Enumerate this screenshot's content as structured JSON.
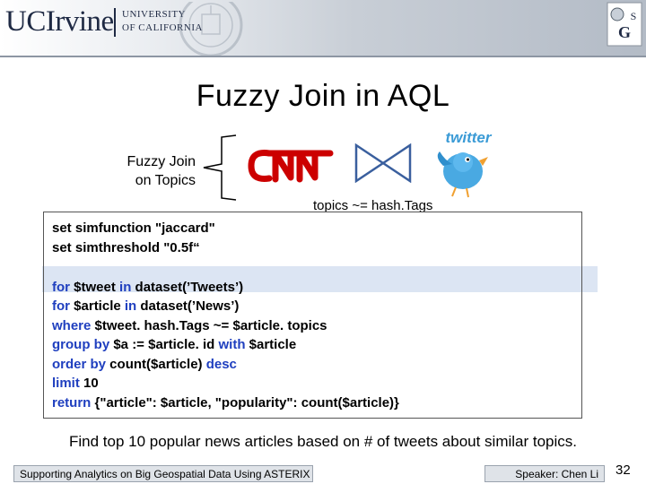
{
  "header": {
    "brand": "UCIrvine",
    "university_line1": "UNIVERSITY",
    "university_line2": "OF CALIFORNIA",
    "isg_logo_text": "ISG"
  },
  "slide": {
    "title": "Fuzzy Join in AQL",
    "fuzzy_label_line1": "Fuzzy Join",
    "fuzzy_label_line2": "on Topics",
    "topics_label": "topics ~= hash.Tags",
    "cnn_logo_icon": "cnn-logo",
    "twitter_logo_icon": "twitter-bird-logo",
    "twitter_text": "twitter"
  },
  "code": {
    "line1": "set simfunction \"jaccard\"",
    "line2": "set simthreshold \"0.5f“",
    "line3_kw1": "for",
    "line3_a": " $tweet ",
    "line3_kw2": "in",
    "line3_b": " dataset(’Tweets’)",
    "line4_kw1": "for",
    "line4_a": " $article ",
    "line4_kw2": "in",
    "line4_b": " dataset(’News’)",
    "line5_kw": "where",
    "line5_a": " $tweet. hash.Tags ~= $article. topics",
    "line6_kw1": "group by",
    "line6_a": " $a := $article. id ",
    "line6_kw2": "with",
    "line6_b": " $article",
    "line7_kw1": "order by",
    "line7_a": " count($article) ",
    "line7_kw2": "desc",
    "line8_kw": "limit",
    "line8_a": " 10",
    "line9_kw": "return",
    "line9_a": " {\"article\": $article, \"popularity\": count($article)}"
  },
  "caption": "Find top 10 popular news articles based on # of tweets about similar topics.",
  "footer": {
    "left": "Supporting Analytics on Big Geospatial Data Using ASTERIX",
    "right": "Speaker: Chen Li",
    "page_number": "32"
  },
  "colors": {
    "keyword": "#1f3fbf",
    "highlight": "#dce5f3",
    "banner": "#b9c1cb"
  }
}
